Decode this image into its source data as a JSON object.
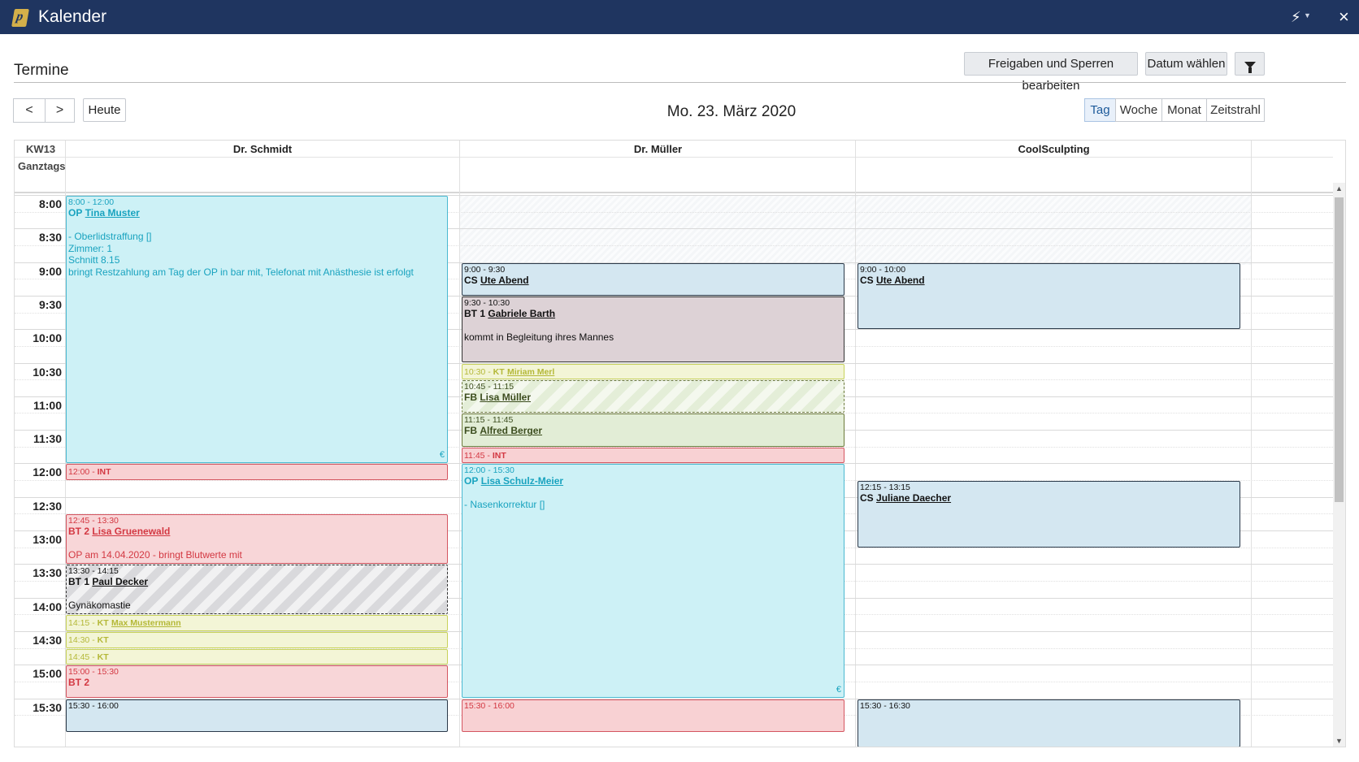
{
  "window": {
    "title": "Kalender",
    "bolt_icon": "bolt-icon",
    "close_icon": "close-icon",
    "close_glyph": "×"
  },
  "page": {
    "title": "Termine"
  },
  "toolbar": {
    "release_button": "Freigaben und Sperren bearbeiten",
    "date_button": "Datum wählen",
    "filter_icon": "filter-icon"
  },
  "nav": {
    "prev_glyph": "<",
    "next_glyph": ">",
    "today_label": "Heute",
    "current_date": "Mo. 23. März 2020"
  },
  "views": [
    {
      "label": "Tag",
      "active": true
    },
    {
      "label": "Woche",
      "active": false
    },
    {
      "label": "Monat",
      "active": false
    },
    {
      "label": "Zeitstrahl",
      "active": false
    }
  ],
  "calendar": {
    "week": "KW13",
    "allday_label": "Ganztags",
    "columns": [
      "Dr. Schmidt",
      "Dr. Müller",
      "CoolSculpting"
    ],
    "times": [
      "8:00",
      "8:30",
      "9:00",
      "9:30",
      "10:00",
      "10:30",
      "11:00",
      "11:30",
      "12:00",
      "12:30",
      "13:00",
      "13:30",
      "14:00",
      "14:30",
      "15:00",
      "15:30"
    ]
  },
  "events": [
    {
      "col": 0,
      "start": "8:00",
      "end": "12:00",
      "type": "op",
      "time": "8:00 - 12:00",
      "code": "OP",
      "patient": "Tina Muster",
      "notes": [
        "",
        "- Oberlidstraffung []",
        "Zimmer: 1",
        "Schnitt 8.15",
        "bringt Restzahlung am Tag der OP in bar mit, Telefonat mit Anästhesie ist erfolgt"
      ],
      "euro": "€"
    },
    {
      "col": 0,
      "start": "12:00",
      "end": "12:15",
      "type": "int",
      "time": "12:00 - ",
      "code": "INT",
      "patient": "",
      "notes": []
    },
    {
      "col": 0,
      "start": "12:45",
      "end": "13:30",
      "type": "bt2",
      "time": "12:45 - 13:30",
      "code": "BT 2",
      "patient": "Lisa Gruenewald",
      "notes": [
        "",
        "OP am 14.04.2020 - bringt Blutwerte mit"
      ]
    },
    {
      "col": 0,
      "start": "13:30",
      "end": "14:15",
      "type": "bt1s",
      "time": "13:30 - 14:15",
      "code": "BT 1",
      "patient": "Paul Decker",
      "notes": [
        "",
        "Gynäkomastie"
      ]
    },
    {
      "col": 0,
      "start": "14:15",
      "end": "14:30",
      "type": "kt",
      "time": "14:15 - ",
      "code": "KT",
      "patient": "Max Mustermann",
      "notes": []
    },
    {
      "col": 0,
      "start": "14:30",
      "end": "14:45",
      "type": "kt",
      "time": "14:30 - ",
      "code": "KT",
      "patient": "",
      "notes": []
    },
    {
      "col": 0,
      "start": "14:45",
      "end": "15:00",
      "type": "kt",
      "time": "14:45 - ",
      "code": "KT",
      "patient": "",
      "notes": []
    },
    {
      "col": 0,
      "start": "15:00",
      "end": "15:30",
      "type": "bt2",
      "time": "15:00 - 15:30",
      "code": "BT 2",
      "patient": "",
      "notes": []
    },
    {
      "col": 0,
      "start": "15:30",
      "end": "16:00",
      "type": "cs",
      "time": "15:30 - 16:00",
      "code": "",
      "patient": "",
      "notes": []
    },
    {
      "col": 1,
      "start": "9:00",
      "end": "9:30",
      "type": "cs",
      "time": "9:00 - 9:30",
      "code": "CS",
      "patient": "Ute Abend",
      "notes": []
    },
    {
      "col": 1,
      "start": "9:30",
      "end": "10:30",
      "type": "bt1",
      "time": "9:30 - 10:30",
      "code": "BT 1",
      "patient": "Gabriele Barth",
      "notes": [
        "",
        "kommt in Begleitung ihres Mannes"
      ]
    },
    {
      "col": 1,
      "start": "10:30",
      "end": "10:45",
      "type": "kt",
      "time": "10:30 - ",
      "code": "KT",
      "patient": "Miriam Merl",
      "notes": []
    },
    {
      "col": 1,
      "start": "10:45",
      "end": "11:15",
      "type": "fbs",
      "time": "10:45 - 11:15",
      "code": "FB",
      "patient": "Lisa Müller",
      "notes": []
    },
    {
      "col": 1,
      "start": "11:15",
      "end": "11:45",
      "type": "fb",
      "time": "11:15 - 11:45",
      "code": "FB",
      "patient": "Alfred Berger",
      "notes": []
    },
    {
      "col": 1,
      "start": "11:45",
      "end": "12:00",
      "type": "int",
      "time": "11:45 - ",
      "code": "INT",
      "patient": "",
      "notes": []
    },
    {
      "col": 1,
      "start": "12:00",
      "end": "15:30",
      "type": "op",
      "time": "12:00 - 15:30",
      "code": "OP",
      "patient": "Lisa Schulz-Meier",
      "notes": [
        "",
        "- Nasenkorrektur []"
      ],
      "euro": "€"
    },
    {
      "col": 1,
      "start": "15:30",
      "end": "16:00",
      "type": "int",
      "time": "15:30 - 16:00",
      "code": "",
      "patient": "",
      "notes": []
    },
    {
      "col": 2,
      "start": "9:00",
      "end": "10:00",
      "type": "cs",
      "time": "9:00 - 10:00",
      "code": "CS",
      "patient": "Ute Abend",
      "notes": []
    },
    {
      "col": 2,
      "start": "12:15",
      "end": "13:15",
      "type": "cs",
      "time": "12:15 - 13:15",
      "code": "CS",
      "patient": "Juliane Daecher",
      "notes": []
    },
    {
      "col": 2,
      "start": "15:30",
      "end": "16:30",
      "type": "cs",
      "time": "15:30 - 16:30",
      "code": "",
      "patient": "",
      "notes": []
    }
  ]
}
